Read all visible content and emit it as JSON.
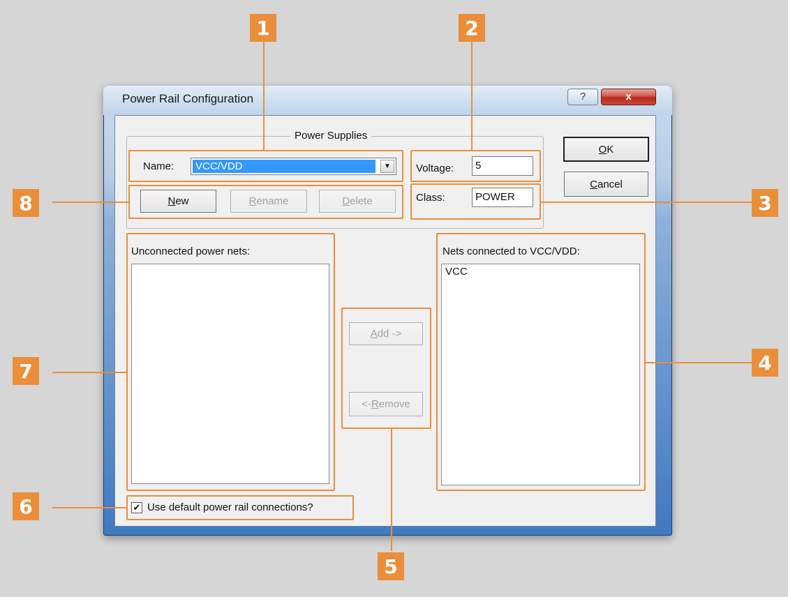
{
  "window": {
    "title": "Power Rail Configuration",
    "help_glyph": "?",
    "close_glyph": "x"
  },
  "power_supplies": {
    "group_label": "Power Supplies",
    "name_label": "Name:",
    "name_value": "VCC/VDD",
    "voltage_label": "Voltage:",
    "voltage_value": "5",
    "class_label": "Class:",
    "class_value": "POWER",
    "buttons": {
      "new_mnemonic": "N",
      "new_rest": "ew",
      "rename_mnemonic": "R",
      "rename_rest": "ename",
      "delete_mnemonic": "D",
      "delete_rest": "elete"
    }
  },
  "dialog_buttons": {
    "ok_mnemonic": "O",
    "ok_rest": "K",
    "cancel_mnemonic": "C",
    "cancel_rest": "ancel"
  },
  "unconnected": {
    "label": "Unconnected power nets:",
    "items": []
  },
  "connected": {
    "label": "Nets connected to VCC/VDD:",
    "items": [
      "VCC"
    ]
  },
  "transfer": {
    "add_mnemonic": "A",
    "add_rest": "dd ->",
    "remove_prefix": "<- ",
    "remove_mnemonic": "R",
    "remove_rest": "emove"
  },
  "default_connections": {
    "label": "Use default power rail connections?",
    "checked": true,
    "check_glyph": "✔"
  },
  "callouts": [
    "1",
    "2",
    "3",
    "4",
    "5",
    "6",
    "7",
    "8"
  ],
  "colors": {
    "annotation": "#ea8e3b",
    "selection": "#3399ff",
    "close_button": "#c9473a"
  }
}
